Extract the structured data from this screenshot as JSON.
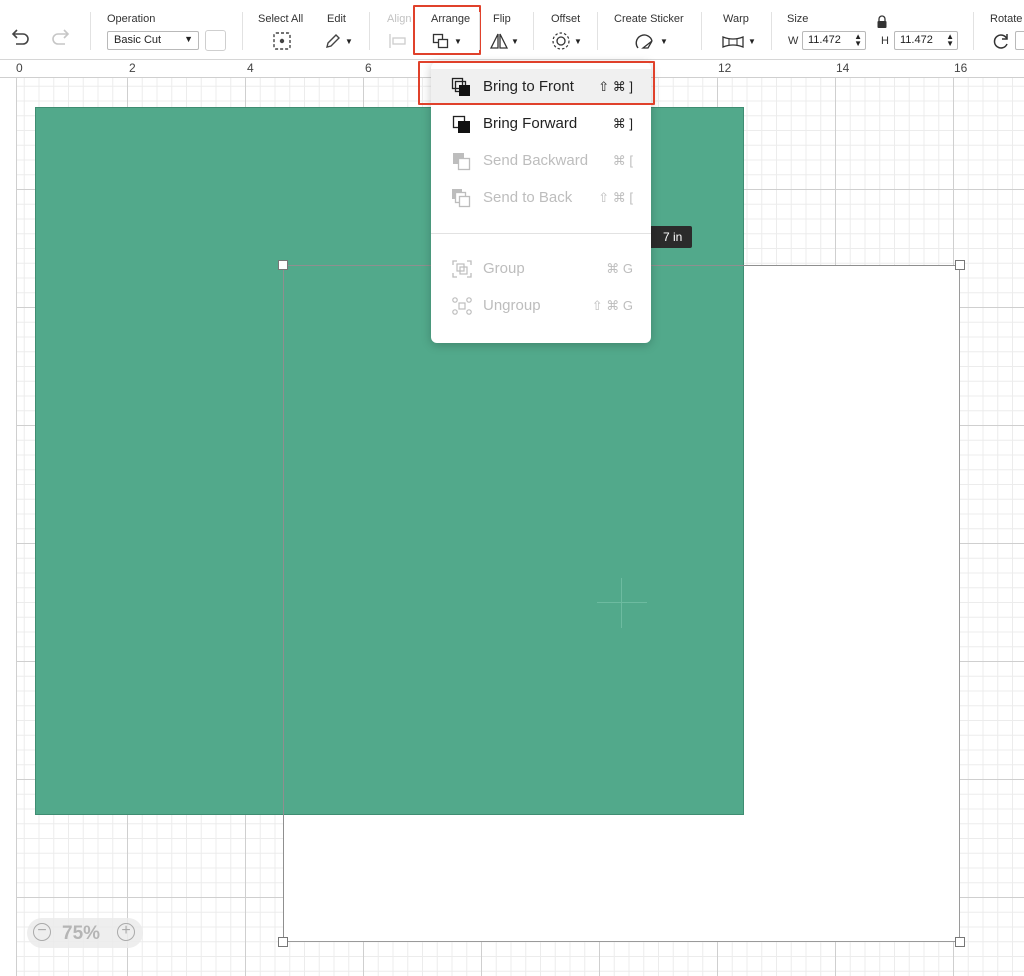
{
  "toolbar": {
    "undo_icon": "undo-icon",
    "redo_icon": "redo-icon",
    "operation": {
      "label": "Operation",
      "value": "Basic Cut"
    },
    "select_all": {
      "label": "Select All"
    },
    "edit": {
      "label": "Edit"
    },
    "align": {
      "label": "Align"
    },
    "arrange": {
      "label": "Arrange"
    },
    "flip": {
      "label": "Flip"
    },
    "offset": {
      "label": "Offset"
    },
    "create_sticker": {
      "label": "Create Sticker"
    },
    "warp": {
      "label": "Warp"
    },
    "size": {
      "label": "Size",
      "w_prefix": "W",
      "w_value": "11.472",
      "h_prefix": "H",
      "h_value": "11.472"
    },
    "rotate": {
      "label": "Rotate"
    }
  },
  "ruler": {
    "top_numbers": [
      "0",
      "2",
      "4",
      "6",
      "12",
      "14",
      "16"
    ]
  },
  "canvas": {
    "tooltip_text": "7  in",
    "zoom_value": "75%",
    "shape_colors": {
      "green": "#52a98b",
      "white": "#ffffff"
    }
  },
  "arrange_menu": {
    "items": [
      {
        "label": "Bring to Front",
        "shortcut": "⇧ ⌘ ]",
        "enabled": true,
        "icon": "bring-to-front-icon"
      },
      {
        "label": "Bring Forward",
        "shortcut": "⌘ ]",
        "enabled": true,
        "icon": "bring-forward-icon"
      },
      {
        "label": "Send Backward",
        "shortcut": "⌘ [",
        "enabled": false,
        "icon": "send-backward-icon"
      },
      {
        "label": "Send to Back",
        "shortcut": "⇧ ⌘ [",
        "enabled": false,
        "icon": "send-to-back-icon"
      },
      {
        "label": "Group",
        "shortcut": "⌘ G",
        "enabled": false,
        "icon": "group-icon"
      },
      {
        "label": "Ungroup",
        "shortcut": "⇧ ⌘ G",
        "enabled": false,
        "icon": "ungroup-icon"
      }
    ]
  },
  "highlight_color": "#e0412b"
}
